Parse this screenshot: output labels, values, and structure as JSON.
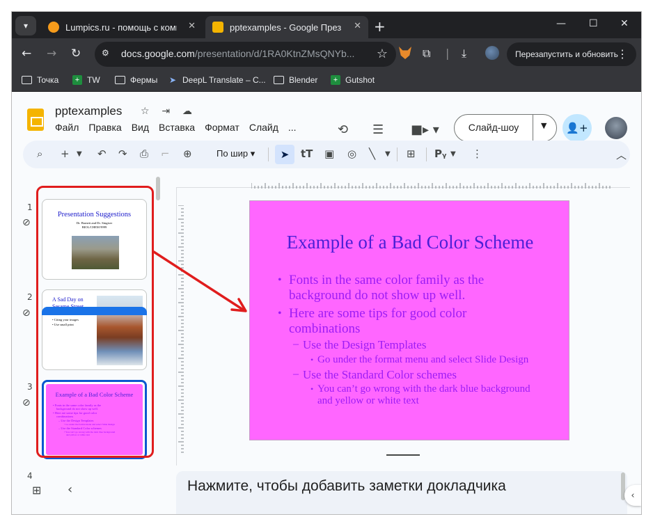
{
  "browser": {
    "tabs": [
      {
        "title": "Lumpics.ru - помощь с компьютером",
        "favicon": "orange-circle"
      },
      {
        "title": "pptexamples - Google Презентации",
        "favicon": "slides-icon"
      }
    ],
    "url_host": "docs.google.com",
    "url_path": "/presentation/d/1RA0KtnZMsQNYb...",
    "restart_label": "Перезапустить и обновить",
    "bookmarks": [
      {
        "label": "Точка",
        "icon": "folder-icon"
      },
      {
        "label": "TW",
        "icon": "green-plus-icon"
      },
      {
        "label": "Фермы",
        "icon": "folder-icon"
      },
      {
        "label": "DeepL Translate – C...",
        "icon": "deepl-icon"
      },
      {
        "label": "Blender",
        "icon": "folder-icon"
      },
      {
        "label": "Gutshot",
        "icon": "green-plus-icon"
      }
    ]
  },
  "doc": {
    "title": "pptexamples",
    "menu": [
      "Файл",
      "Правка",
      "Вид",
      "Вставка",
      "Формат",
      "Слайд",
      "..."
    ],
    "slideshow_label": "Слайд-шоу"
  },
  "toolbar": {
    "zoom_label": "По шир"
  },
  "filmstrip": {
    "numbers": [
      "1",
      "2",
      "3",
      "4"
    ],
    "slide1": {
      "title": "Presentation Suggestions",
      "line1": "Dr. Barnett and Dr. Singiser",
      "line2": "BIOL/CHEM 9999"
    },
    "slide2": {
      "title": "A Sad Day on Sesame Street",
      "bullets": [
        "Citing your images",
        "Use small print"
      ]
    },
    "slide3": {
      "title": "Example of a Bad Color Scheme"
    }
  },
  "slide": {
    "title": "Example of a Bad Color Scheme",
    "bullet1": "Fonts in the same color family as the",
    "bullet1b": "background do not show up well.",
    "bullet2": "Here are some tips for good color",
    "bullet2b": "combinations",
    "sub1": "Use the Design Templates",
    "subsub1": "Go under the format menu and select Slide Design",
    "sub2": "Use the Standard Color schemes",
    "subsub2": "You can’t go wrong with the dark blue background",
    "subsub2b": "and yellow or white text",
    "colors": {
      "background": "#ff66ff",
      "title": "#4b1fd6",
      "body": "#9d1cf5"
    }
  },
  "notes": {
    "placeholder": "Нажмите, чтобы добавить заметки докладчика"
  },
  "annotation": {
    "highlight_color": "#e01d1d"
  }
}
